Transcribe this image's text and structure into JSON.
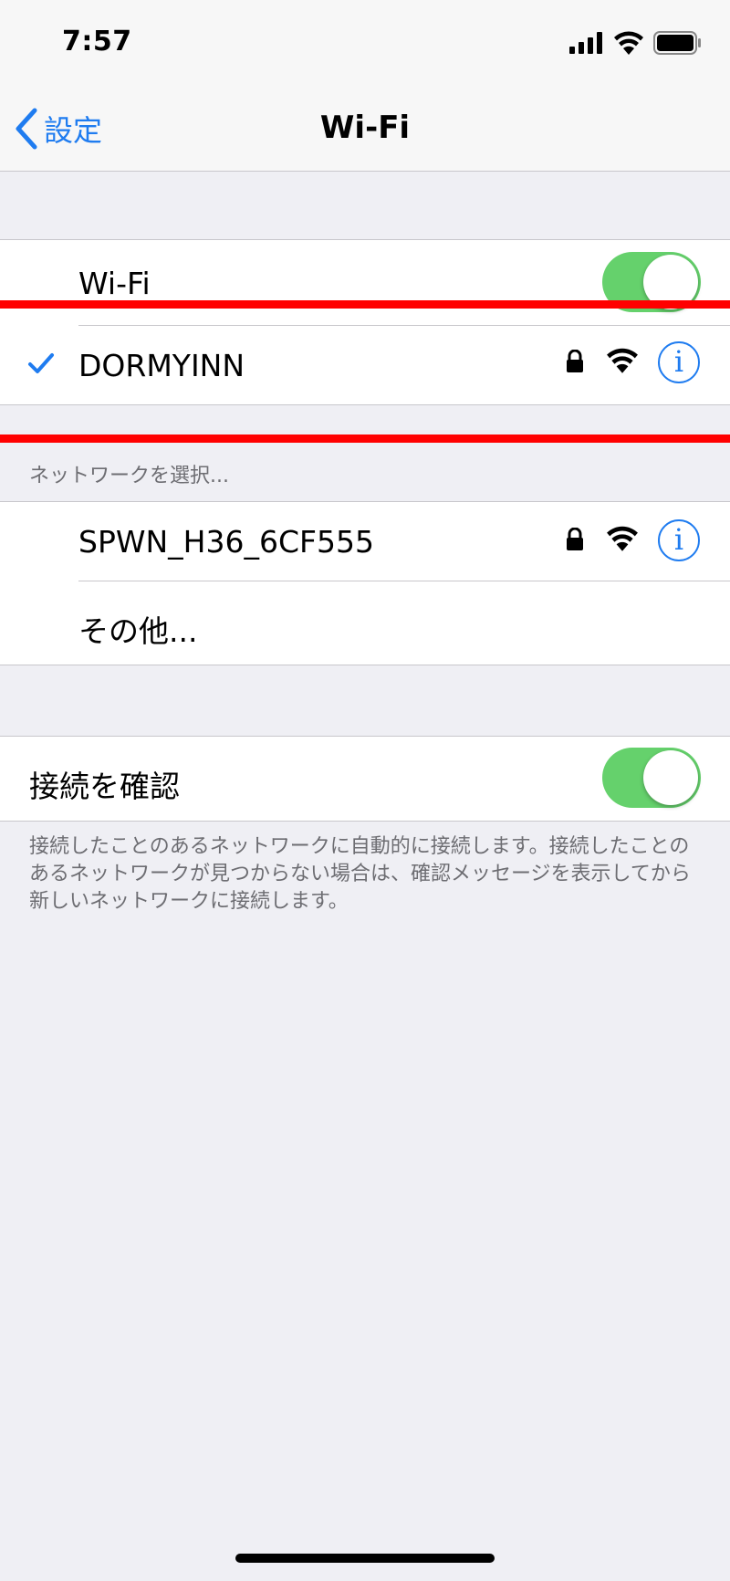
{
  "status_bar": {
    "time": "7:57"
  },
  "nav": {
    "back_label": "設定",
    "title": "Wi-Fi"
  },
  "wifi_toggle": {
    "label": "Wi-Fi",
    "on": true
  },
  "connected_network": {
    "name": "DORMYINN",
    "secured": true,
    "info_label": "i"
  },
  "network_section": {
    "header": "ネットワークを選択..."
  },
  "networks": [
    {
      "name": "SPWN_H36_6CF555",
      "secured": true,
      "info_label": "i"
    }
  ],
  "other_label": "その他...",
  "ask_join": {
    "label": "接続を確認",
    "on": true,
    "footer": "接続したことのあるネットワークに自動的に接続します。接続したことのあるネットワークが見つからない場合は、確認メッセージを表示してから新しいネットワークに接続します。"
  },
  "colors": {
    "accent": "#1f7cf0",
    "toggle_on": "#65d16c",
    "annotation": "#ff0000"
  },
  "icons": [
    "cellular-signal-icon",
    "wifi-icon",
    "battery-icon",
    "chevron-left-icon",
    "checkmark-icon",
    "lock-icon",
    "wifi-strength-icon",
    "info-icon"
  ]
}
